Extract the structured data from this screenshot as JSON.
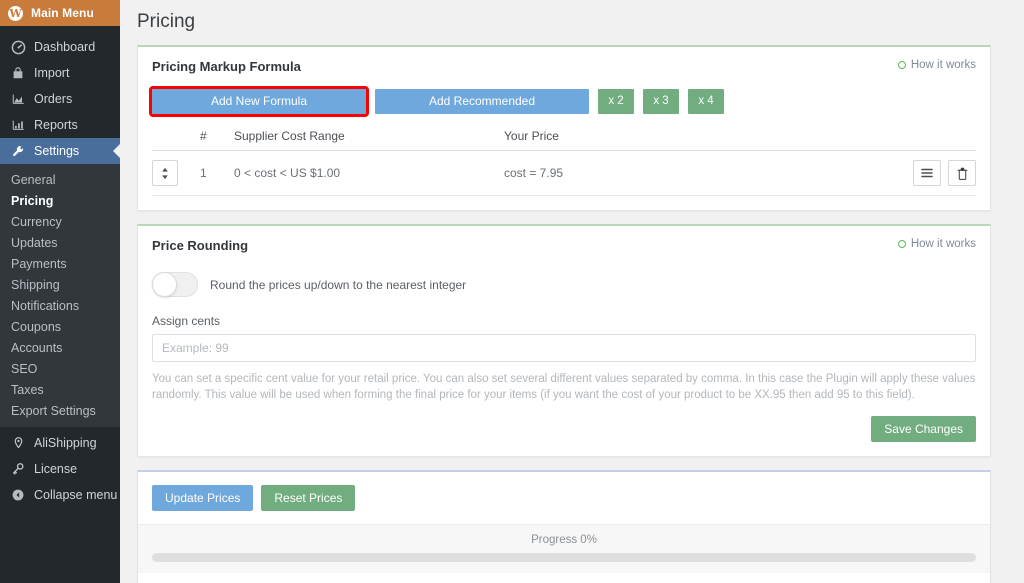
{
  "sidebar": {
    "menu_top": {
      "label": "Main Menu",
      "logo": "wordpress-logo",
      "bg": "#c97b3c"
    },
    "main_items": [
      {
        "label": "Dashboard",
        "icon": "gauge-icon"
      },
      {
        "label": "Import",
        "icon": "bag-icon"
      },
      {
        "label": "Orders",
        "icon": "area-chart-icon"
      },
      {
        "label": "Reports",
        "icon": "bar-chart-icon"
      },
      {
        "label": "Settings",
        "icon": "wrench-icon",
        "active": true
      }
    ],
    "submenu": [
      {
        "label": "General"
      },
      {
        "label": "Pricing",
        "current": true
      },
      {
        "label": "Currency"
      },
      {
        "label": "Updates"
      },
      {
        "label": "Payments"
      },
      {
        "label": "Shipping"
      },
      {
        "label": "Notifications"
      },
      {
        "label": "Coupons"
      },
      {
        "label": "Accounts"
      },
      {
        "label": "SEO"
      },
      {
        "label": "Taxes"
      },
      {
        "label": "Export Settings"
      }
    ],
    "bottom_items": [
      {
        "label": "AliShipping",
        "icon": "location-pin-icon"
      },
      {
        "label": "License",
        "icon": "key-icon"
      },
      {
        "label": "Collapse menu",
        "icon": "collapse-arrow-icon"
      }
    ],
    "active_color": "#4a6e9c"
  },
  "page": {
    "title": "Pricing"
  },
  "markup_panel": {
    "title": "Pricing Markup Formula",
    "how_it_works": "How it works",
    "buttons": {
      "add_new_formula": "Add New Formula",
      "add_recommended": "Add Recommended",
      "multipliers": [
        "x 2",
        "x 3",
        "x 4"
      ]
    },
    "highlight_color": "#ff0000",
    "table": {
      "headers": [
        "",
        "#",
        "Supplier Cost Range",
        "Your Price",
        ""
      ],
      "rows": [
        {
          "num": "1",
          "range": "0 < cost < US $1.00",
          "price": "cost = 7.95",
          "handle_icon": "sort-updown-icon",
          "menu_icon": "hamburger-icon",
          "delete_icon": "trash-icon"
        }
      ]
    }
  },
  "rounding_panel": {
    "title": "Price Rounding",
    "how_it_works": "How it works",
    "toggle_label": "Round the prices up/down to the nearest integer",
    "toggle_state": "off",
    "assign_cents_label": "Assign cents",
    "assign_cents_value": "",
    "assign_cents_placeholder": "Example: 99",
    "help_text": "You can set a specific cent value for your retail price. You can also set several different values separated by comma. In this case the Plugin will apply these values randomly. This value will be used when forming the final price for your items (if you want the cost of your product to be XX.95 then add 95 to this field).",
    "save_label": "Save Changes"
  },
  "actions_panel": {
    "update_prices": "Update Prices",
    "reset_prices": "Reset Prices",
    "progress_label": "Progress 0%",
    "progress_percent": 0
  },
  "colors": {
    "blue": "#6fa8dc",
    "green": "#72ad7f",
    "panel_top_green": "#b8d8b8",
    "panel_top_blue": "#c4cdea"
  }
}
